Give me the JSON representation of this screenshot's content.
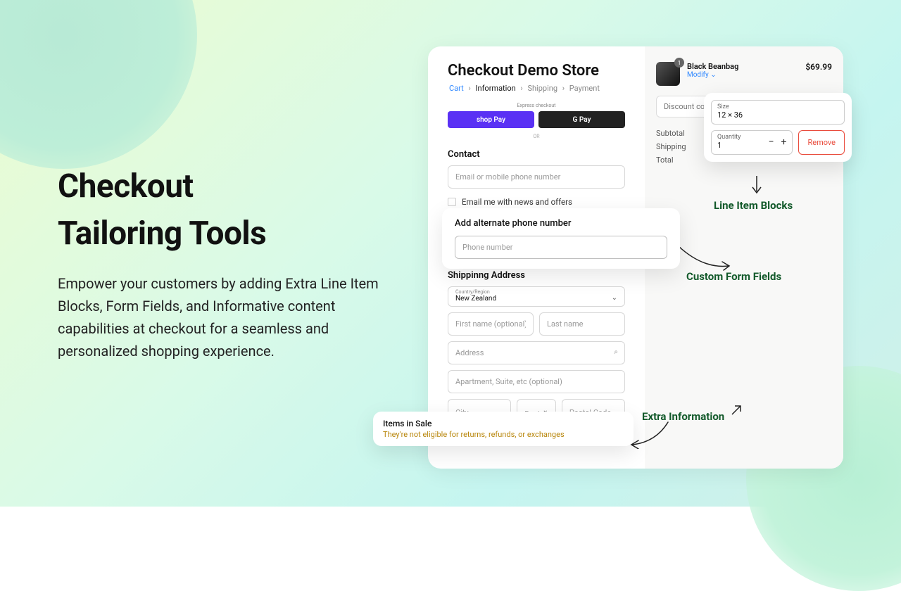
{
  "promo": {
    "title_line1": "Checkout",
    "title_line2": "Tailoring Tools",
    "body": "Empower your customers by adding Extra Line Item Blocks, Form Fields, and Informative content capabilities at checkout for a seamless and personalized shopping experience."
  },
  "store": {
    "title": "Checkout Demo Store"
  },
  "crumbs": {
    "cart": "Cart",
    "info": "Information",
    "ship": "Shipping",
    "pay": "Payment",
    "sep": "›"
  },
  "express": {
    "label": "Express checkout",
    "shoppay": "shop Pay",
    "gpay": "G Pay",
    "or": "OR"
  },
  "contact": {
    "label": "Contact",
    "placeholder": "Email or mobile phone number",
    "news": "Email me with news and offers"
  },
  "alt_phone": {
    "title": "Add alternate phone number",
    "placeholder": "Phone number"
  },
  "shipping": {
    "label": "Shippinng Address",
    "country_label": "Country/Region",
    "country_value": "New Zealand",
    "first": "First name (optional)",
    "last": "Last name",
    "address": "Address",
    "apt": "Apartment, Suite, etc (optional)",
    "city": "City",
    "region": "Region",
    "postal": "Postal Code"
  },
  "sale": {
    "title": "Items in Sale",
    "text": "They're not eligible for returns, refunds, or exchanges"
  },
  "item": {
    "name": "Black Beanbag",
    "modify": "Modify",
    "price": "$69.99",
    "badge": "1"
  },
  "discount_placeholder": "Discount code",
  "summary": {
    "subtotal": "Subtotal",
    "shipping": "Shipping",
    "total": "Total"
  },
  "modify_pop": {
    "size_label": "Size",
    "size_value": "12 × 36",
    "qty_label": "Quantity",
    "qty_value": "1",
    "remove": "Remove"
  },
  "callouts": {
    "line_item": "Line Item Blocks",
    "custom_form": "Custom Form Fields",
    "extra_info": "Extra Information"
  }
}
